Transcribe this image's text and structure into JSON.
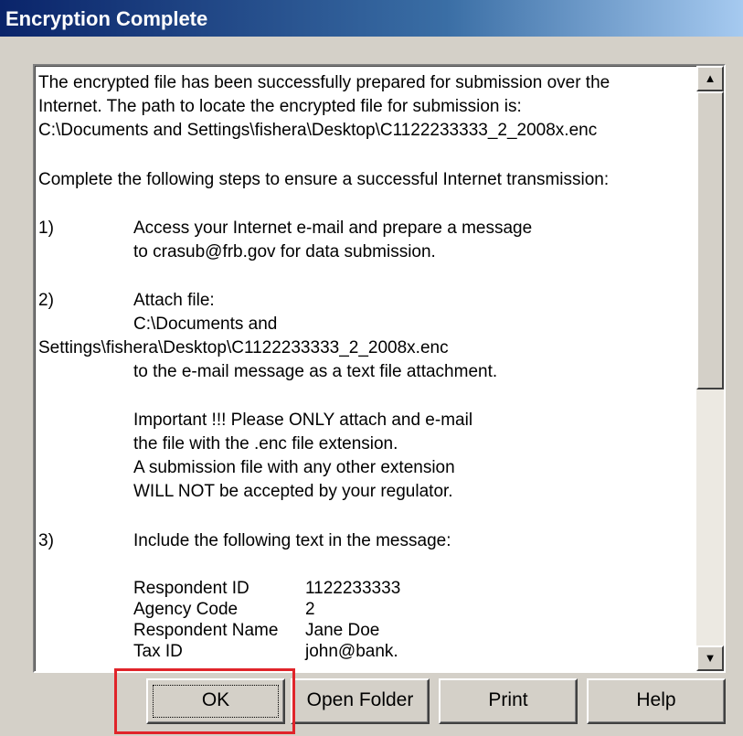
{
  "window": {
    "title": "Encryption Complete"
  },
  "message": {
    "lines": [
      "The encrypted file has been successfully prepared for submission over the",
      "Internet. The path to locate the encrypted file for submission is:",
      "C:\\Documents and Settings\\fishera\\Desktop\\C1122233333_2_2008x.enc",
      "Complete the following steps to ensure a successful Internet transmission:",
      "1)",
      "Access your Internet e-mail and prepare a message",
      "to crasub@frb.gov for data submission.",
      "2)",
      "Attach file:",
      "C:\\Documents and",
      "Settings\\fishera\\Desktop\\C1122233333_2_2008x.enc",
      "to the e-mail message as a text file attachment.",
      "Important !!! Please ONLY attach and e-mail",
      "the file with the .enc file extension.",
      "A submission file with any other extension",
      "WILL NOT be accepted by your regulator.",
      "3)",
      "Include the following text in the message:",
      "Respondent ID",
      "1122233333",
      "Agency Code",
      "2",
      "Respondent Name",
      "Jane Doe",
      "Tax ID",
      "john@bank."
    ]
  },
  "scrollbar": {
    "up_icon": "▲",
    "down_icon": "▼"
  },
  "buttons": {
    "ok": "OK",
    "open_folder": "Open Folder",
    "print": "Print",
    "help": "Help"
  },
  "colors": {
    "title_start": "#0a246a",
    "title_end": "#a6caf0",
    "dialog_face": "#d4d0c8",
    "highlight": "#e0242a"
  }
}
